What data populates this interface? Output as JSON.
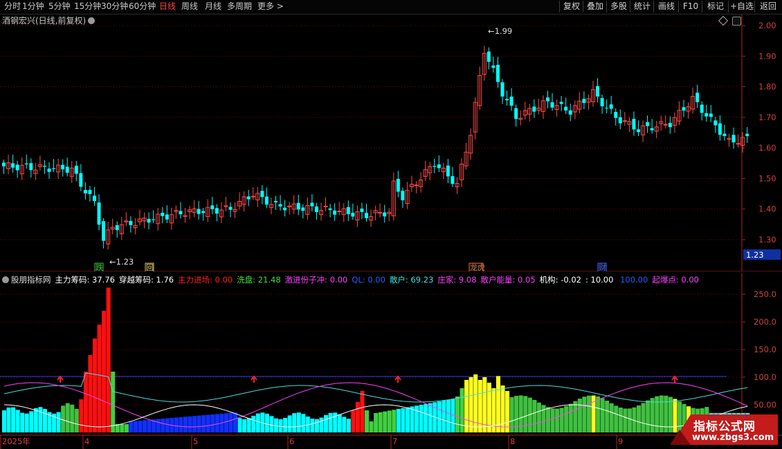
{
  "toolbar": {
    "periods": [
      "分时",
      "1分钟",
      "5分钟",
      "15分钟",
      "30分钟",
      "60分钟",
      "日线",
      "周线",
      "月线",
      "多周期",
      "更多 >"
    ],
    "active_period": "日线",
    "buttons": [
      "复权",
      "叠加",
      "多股",
      "统计",
      "画线",
      "F10",
      "标记",
      "+自选",
      "返回"
    ]
  },
  "stock": {
    "title": "酒钢宏兴(日线,前复权)",
    "price_axis": [
      "2.00",
      "1.90",
      "1.80",
      "1.70",
      "1.60",
      "1.50",
      "1.40",
      "1.30"
    ],
    "current_price": "1.23",
    "high_label": "1.99",
    "low_label": "1.23",
    "event_tags": [
      "跌",
      "回",
      "龙虎",
      "财"
    ]
  },
  "indicator": {
    "name": "股朋指标网",
    "items": [
      {
        "label": "主力筹码:",
        "value": "37.76",
        "color": "#ffffff"
      },
      {
        "label": "穿越筹码:",
        "value": "1.76",
        "color": "#ffffff"
      },
      {
        "label": "主力进场:",
        "value": "0.00",
        "color": "#ff2020"
      },
      {
        "label": "洗盘:",
        "value": "21.48",
        "color": "#40e040"
      },
      {
        "label": "激进份子冲:",
        "value": "0.00",
        "color": "#ff40ff"
      },
      {
        "label": "QL:",
        "value": "0.00",
        "color": "#2060ff"
      },
      {
        "label": "散户:",
        "value": "69.23",
        "color": "#40e0e0"
      },
      {
        "label": "庄家:",
        "value": "9.08",
        "color": "#ff40ff"
      },
      {
        "label": "散户能量:",
        "value": "0.05",
        "color": "#ff40ff"
      },
      {
        "label": "机构:",
        "value": "-0.02",
        "color": "#ffffff"
      },
      {
        "label": ":",
        "value": "10.00",
        "color": "#ffffff"
      },
      {
        "label": "",
        "value": "100.00",
        "color": "#2060ff"
      },
      {
        "label": "起爆点:",
        "value": "0.00",
        "color": "#ff40ff"
      }
    ],
    "axis": [
      "250.0",
      "200.0",
      "150.0",
      "100.0",
      "50.00"
    ]
  },
  "time_axis": [
    "2025年",
    "4",
    "5",
    "6",
    "7",
    "8",
    "9"
  ],
  "watermark": {
    "title": "指标公式网",
    "url": "www.zbgs3.com"
  },
  "colors": {
    "up": "#ff4a4a",
    "down": "#00ffff",
    "grid": "#8b0000",
    "axis": "#b02020"
  }
}
